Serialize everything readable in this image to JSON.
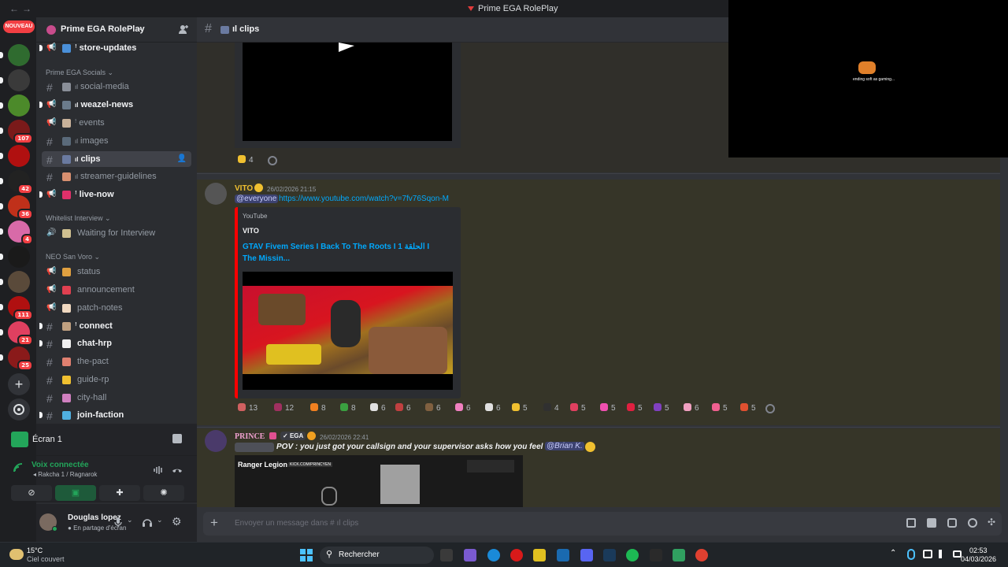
{
  "titlebar": {
    "title": "Prime EGA RolePlay",
    "back": "←",
    "forward": "→"
  },
  "rail": {
    "new_badge": "NOUVEAU",
    "servers": [
      {
        "color": "#2f6b2f",
        "badge": ""
      },
      {
        "color": "#3a3a3a",
        "badge": ""
      },
      {
        "color": "#4c8a2a",
        "badge": ""
      },
      {
        "color": "#7a1a1a",
        "badge": "107"
      },
      {
        "color": "#b01010",
        "badge": ""
      },
      {
        "color": "#222222",
        "badge": "42"
      },
      {
        "color": "#c0301a",
        "badge": "36"
      },
      {
        "color": "#d86aa8",
        "badge": "4"
      },
      {
        "color": "#1a1a1a",
        "badge": ""
      },
      {
        "color": "#5a4a3a",
        "badge": ""
      },
      {
        "color": "#b01010",
        "badge": "111"
      },
      {
        "color": "#e04060",
        "badge": "21"
      },
      {
        "color": "#8a1a1a",
        "badge": "25"
      }
    ],
    "add_icon": "+",
    "discover_icon": "compass"
  },
  "server": {
    "name": "Prime EGA RolePlay"
  },
  "categories": {
    "socials": "Prime EGA Socials",
    "whitelist": "Whitelist Interview",
    "neo": "NEO San Voro"
  },
  "channels": [
    {
      "name": "store-updates",
      "kind": "announce",
      "unread": true,
      "emoji_color": "#4a90d9",
      "prefix": "ꜝ"
    },
    {
      "name": "social-media",
      "kind": "text",
      "unread": false,
      "emoji_color": "#8a8f98",
      "prefix": "ıl"
    },
    {
      "name": "weazel-news",
      "kind": "announce",
      "unread": true,
      "emoji_color": "#6b7b8c",
      "prefix": "ıl"
    },
    {
      "name": "events",
      "kind": "announce",
      "unread": false,
      "emoji_color": "#c9b29a",
      "prefix": "ꜝ"
    },
    {
      "name": "images",
      "kind": "text",
      "unread": false,
      "emoji_color": "#5a6a7a",
      "prefix": "ıl"
    },
    {
      "name": "clips",
      "kind": "text",
      "active": true,
      "emoji_color": "#6a7aa0",
      "prefix": "ıl"
    },
    {
      "name": "streamer-guidelines",
      "kind": "text",
      "unread": false,
      "emoji_color": "#d89070",
      "prefix": "ıl"
    },
    {
      "name": "live-now",
      "kind": "announce",
      "unread": true,
      "emoji_color": "#e0306a",
      "prefix": "ꜝ"
    },
    {
      "name": "Waiting for Interview",
      "kind": "voice",
      "unread": false,
      "emoji_color": "#d0c090",
      "prefix": ""
    },
    {
      "name": "status",
      "kind": "announce",
      "unread": false,
      "emoji_color": "#e0a040",
      "prefix": ""
    },
    {
      "name": "announcement",
      "kind": "announce",
      "unread": false,
      "emoji_color": "#e04050",
      "prefix": ""
    },
    {
      "name": "patch-notes",
      "kind": "announce",
      "unread": false,
      "emoji_color": "#f0d8c0",
      "prefix": ""
    },
    {
      "name": "connect",
      "kind": "text",
      "unread": true,
      "emoji_color": "#c0a080",
      "prefix": "ꜝ"
    },
    {
      "name": "chat-hrp",
      "kind": "text",
      "unread": true,
      "emoji_color": "#f0f0f0",
      "prefix": ""
    },
    {
      "name": "the-pact",
      "kind": "text",
      "unread": false,
      "emoji_color": "#e08070",
      "prefix": ""
    },
    {
      "name": "guide-rp",
      "kind": "text",
      "unread": false,
      "emoji_color": "#f0c030",
      "prefix": ""
    },
    {
      "name": "city-hall",
      "kind": "text",
      "unread": false,
      "emoji_color": "#d080c0",
      "prefix": ""
    },
    {
      "name": "join-faction",
      "kind": "text",
      "unread": true,
      "emoji_color": "#50b0e0",
      "prefix": ""
    }
  ],
  "screenshare": {
    "label": "Écran 1"
  },
  "voice": {
    "status": "Voix connectée",
    "location": "Rakcha 1 / Ragnarok"
  },
  "user": {
    "name": "Douglas lopez",
    "status": "En partage d'écran"
  },
  "chat": {
    "channel_title": "ıl clips",
    "top_reactions": [
      {
        "emoji_color": "#f0c030",
        "count": "4"
      }
    ],
    "msg1": {
      "author": "VITO",
      "timestamp": "26/02/2026 21:15",
      "mention": "@everyone",
      "link": "https://www.youtube.com/watch?v=7fv76Sqon-M",
      "embed_provider": "YouTube",
      "embed_author": "VITO",
      "embed_title": "GTAV Fivem Series I Back To The Roots I 1 الحلقة I The Missin...",
      "reactions": [
        {
          "emoji_color": "#d06060",
          "count": "13"
        },
        {
          "emoji_color": "#a03060",
          "count": "12"
        },
        {
          "emoji_color": "#f08020",
          "count": "8"
        },
        {
          "emoji_color": "#3aa040",
          "count": "8"
        },
        {
          "emoji_color": "#e0e0e0",
          "count": "6"
        },
        {
          "emoji_color": "#c04040",
          "count": "6"
        },
        {
          "emoji_color": "#806040",
          "count": "6"
        },
        {
          "emoji_color": "#f080c0",
          "count": "6"
        },
        {
          "emoji_color": "#e0e0e0",
          "count": "6"
        },
        {
          "emoji_color": "#f0c030",
          "count": "5"
        },
        {
          "emoji_color": "#303030",
          "count": "4"
        },
        {
          "emoji_color": "#e04060",
          "count": "5"
        },
        {
          "emoji_color": "#f050b0",
          "count": "5"
        },
        {
          "emoji_color": "#e02040",
          "count": "5"
        },
        {
          "emoji_color": "#8040c0",
          "count": "5"
        },
        {
          "emoji_color": "#f0a0c0",
          "count": "6"
        },
        {
          "emoji_color": "#f06090",
          "count": "5"
        },
        {
          "emoji_color": "#e05030",
          "count": "5"
        }
      ]
    },
    "msg2": {
      "author": "PRINCE",
      "tag": "EGA",
      "timestamp": "26/02/2026 22:41",
      "text": "POV : you just got your callsign and your supervisor asks how you feel",
      "mention": "@Brian K.",
      "video_overlay_text": "Ranger Legion",
      "video_overlay_sub": "KICK.COM/PRINCYEN"
    }
  },
  "input": {
    "placeholder": "Envoyer un message dans # ıl clips"
  },
  "overlay": {
    "caption": "ending soft as gaming..."
  },
  "taskbar": {
    "weather_temp": "15°C",
    "weather_desc": "Ciel couvert",
    "search_placeholder": "Rechercher",
    "time": "02:53",
    "date": "04/03/2026"
  }
}
